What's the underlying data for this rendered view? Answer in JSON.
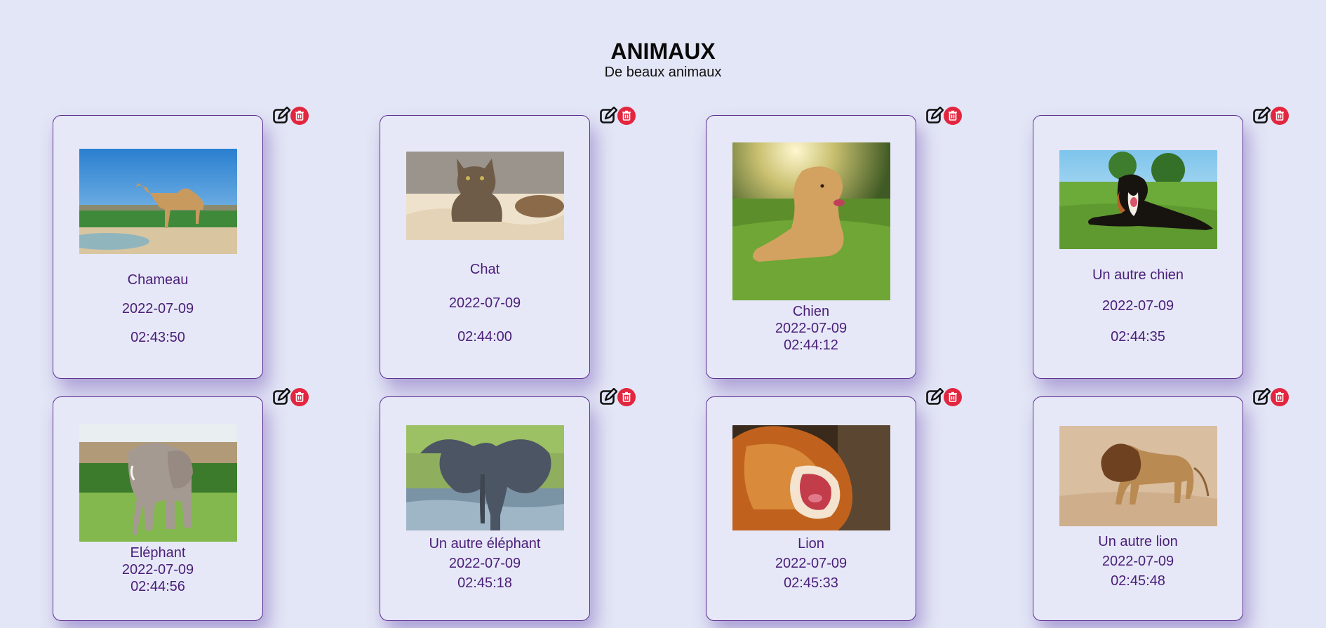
{
  "header": {
    "title": "ANIMAUX",
    "subtitle": "De beaux animaux"
  },
  "icons": {
    "edit": "edit-icon",
    "delete": "trash-icon"
  },
  "colors": {
    "background": "#e3e6f6",
    "card_border": "#5b2d91",
    "card_text": "#4a1e78",
    "delete_button": "#e3263f"
  },
  "cards": [
    {
      "name": "Chameau",
      "date": "2022-07-09",
      "time": "02:43:50",
      "image": "camel-photo"
    },
    {
      "name": "Chat",
      "date": "2022-07-09",
      "time": "02:44:00",
      "image": "cat-photo"
    },
    {
      "name": "Chien",
      "date": "2022-07-09",
      "time": "02:44:12",
      "image": "dog-photo"
    },
    {
      "name": "Un autre chien",
      "date": "2022-07-09",
      "time": "02:44:35",
      "image": "bernese-dog-photo"
    },
    {
      "name": "Eléphant",
      "date": "2022-07-09",
      "time": "02:44:56",
      "image": "elephant-photo"
    },
    {
      "name": "Un autre éléphant",
      "date": "2022-07-09",
      "time": "02:45:18",
      "image": "elephant-water-photo"
    },
    {
      "name": "Lion",
      "date": "2022-07-09",
      "time": "02:45:33",
      "image": "roaring-lion-photo"
    },
    {
      "name": "Un autre lion",
      "date": "2022-07-09",
      "time": "02:45:48",
      "image": "walking-lion-photo"
    }
  ]
}
